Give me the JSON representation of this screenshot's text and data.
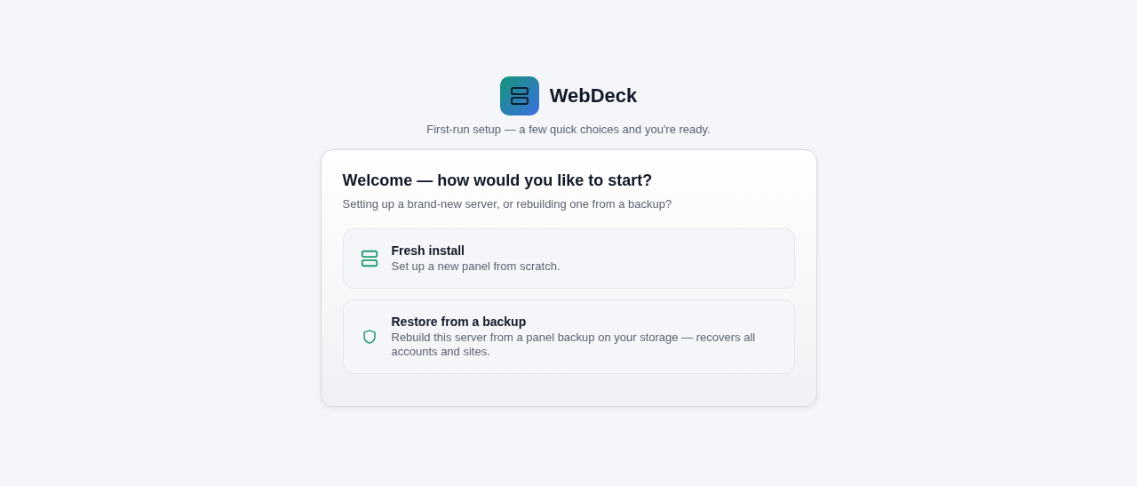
{
  "brand": {
    "name": "WebDeck",
    "tagline": "First-run setup — a few quick choices and you're ready."
  },
  "card": {
    "title": "Welcome — how would you like to start?",
    "subtitle": "Setting up a brand-new server, or rebuilding one from a backup?",
    "options": [
      {
        "kind": "server",
        "title": "Fresh install",
        "description": "Set up a new panel from scratch."
      },
      {
        "kind": "shield",
        "title": "Restore from a backup",
        "description": "Rebuild this server from a panel backup on your storage — recovers all accounts and sites."
      }
    ]
  }
}
